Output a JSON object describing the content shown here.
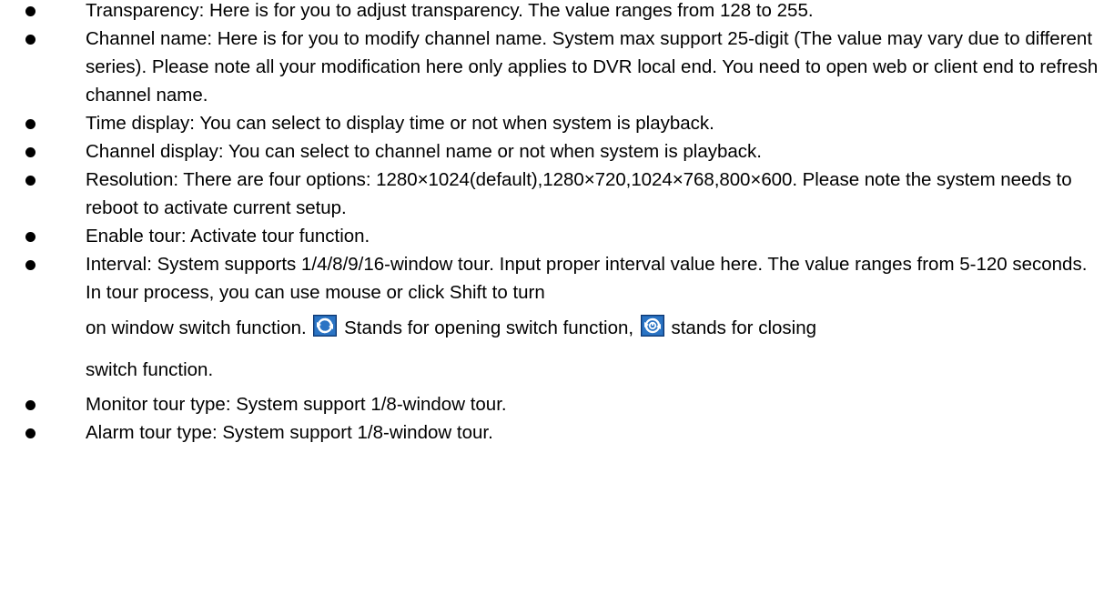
{
  "items": [
    {
      "text": "Transparency: Here is for you to adjust transparency. The value ranges from 128 to 255."
    },
    {
      "text": "Channel name: Here is for you to modify channel name. System max support 25-digit (The value may vary due to different series). Please note all your modification here only applies to DVR local end. You need to open web or client end to refresh channel name."
    },
    {
      "text": "Time display: You can select to display time or not when system is playback."
    },
    {
      "text": "Channel display: You can select to channel name or not when system is playback."
    },
    {
      "text": "Resolution: There are four options: 1280×1024(default),1280×720,1024×768,800×600. Please note the system needs to reboot to activate current setup."
    },
    {
      "text": "Enable tour: Activate tour function."
    },
    {
      "text_part1": "Interval: System supports 1/4/8/9/16-window tour. Input proper interval value here. The value ranges from 5-120 seconds. In tour process, you can use mouse or click Shift to turn",
      "text_part2_before_icon": "on window switch function.",
      "text_part2_middle": "Stands for opening switch function,",
      "text_part2_after_icon": "stands for closing",
      "text_part3": "switch function.",
      "icons": {
        "open_switch": "tour-open-switch-icon",
        "close_switch": "tour-close-switch-icon"
      }
    },
    {
      "text": "Monitor tour type: System support 1/8-window tour."
    },
    {
      "text": "Alarm tour type: System support 1/8-window tour."
    }
  ]
}
